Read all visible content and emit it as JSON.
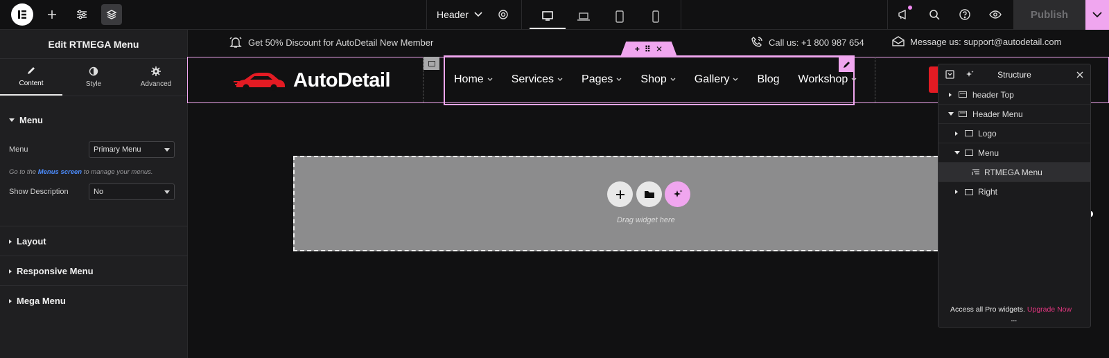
{
  "topbar": {
    "document_name": "Header",
    "publish_label": "Publish",
    "icons": [
      "elementor-logo-icon",
      "add-icon",
      "settings-sliders-icon",
      "layers-icon",
      "header-settings-gear-icon",
      "desktop-icon",
      "laptop-icon",
      "tablet-icon",
      "mobile-icon",
      "notifications-icon",
      "search-icon",
      "help-icon",
      "preview-eye-icon",
      "chevron-down-icon"
    ]
  },
  "panel": {
    "title": "Edit RTMEGA Menu",
    "tabs": [
      {
        "label": "Content",
        "icon": "pencil-icon",
        "active": true
      },
      {
        "label": "Style",
        "icon": "half-circle-icon",
        "active": false
      },
      {
        "label": "Advanced",
        "icon": "gear-icon",
        "active": false
      }
    ],
    "menu_section": {
      "title": "Menu",
      "menu_label": "Menu",
      "menu_value": "Primary Menu",
      "hint_prefix": "Go to the",
      "hint_link": "Menus screen",
      "hint_suffix": "to manage your menus.",
      "show_desc_label": "Show Description",
      "show_desc_value": "No"
    },
    "sections": [
      "Layout",
      "Responsive Menu",
      "Mega Menu"
    ]
  },
  "canvas": {
    "promo_text": "Get 50% Discount for AutoDetail New Member",
    "call_text": "Call us: +1 800 987 654",
    "message_text": "Message us: support@autodetail.com",
    "logo_text": "AutoDetail",
    "menu_items": [
      "Home",
      "Services",
      "Pages",
      "Shop",
      "Gallery",
      "Blog",
      "Workshop"
    ],
    "drop_label": "Drag widget here"
  },
  "structure": {
    "title": "Structure",
    "items": [
      {
        "label": "header Top",
        "expanded": false
      },
      {
        "label": "Header Menu",
        "expanded": true
      },
      {
        "label": "Logo",
        "expanded": false
      },
      {
        "label": "Menu",
        "expanded": true
      },
      {
        "label": "RTMEGA Menu",
        "selected": true
      },
      {
        "label": "Right",
        "expanded": false
      }
    ],
    "upgrade_text": "Access all Pro widgets.",
    "upgrade_link": "Upgrade Now",
    "dots": "..."
  },
  "colors": {
    "accent_pink": "#f0a6ef",
    "brand_red": "#e31b23",
    "link_blue": "#4c8dff",
    "upgrade_pink": "#e1367f"
  }
}
